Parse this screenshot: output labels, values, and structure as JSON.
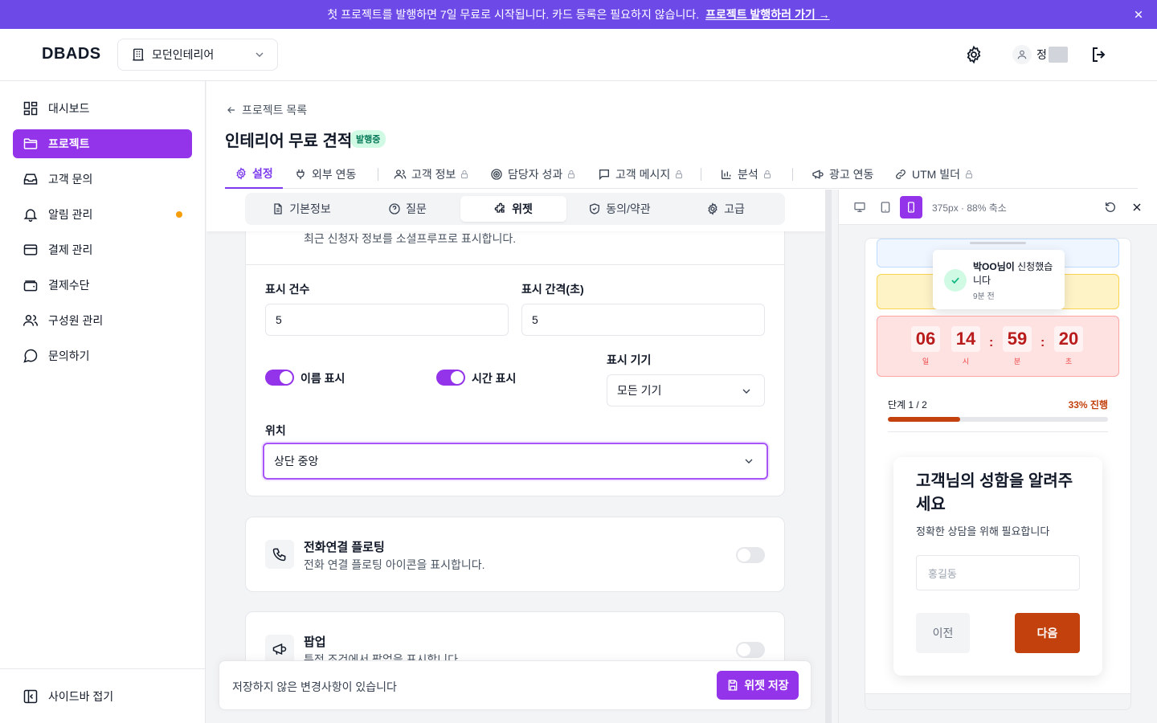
{
  "banner": {
    "text": "첫 프로젝트를 발행하면 7일 무료로 시작됩니다. 카드 등록은 필요하지 않습니다.",
    "link": "프로젝트 발행하러 가기 →"
  },
  "header": {
    "logo": "DBADS",
    "org": "모던인테리어",
    "user_name": "정"
  },
  "sidebar": {
    "items": [
      {
        "label": "대시보드",
        "icon": "dashboard-icon"
      },
      {
        "label": "프로젝트",
        "icon": "folder-icon",
        "active": true
      },
      {
        "label": "고객 문의",
        "icon": "inbox-icon"
      },
      {
        "label": "알림 관리",
        "icon": "bell-icon",
        "dot": true
      },
      {
        "label": "결제 관리",
        "icon": "card-icon"
      },
      {
        "label": "결제수단",
        "icon": "wallet-icon"
      },
      {
        "label": "구성원 관리",
        "icon": "users-icon"
      },
      {
        "label": "문의하기",
        "icon": "chat-icon"
      }
    ],
    "collapse": "사이드바 접기"
  },
  "page": {
    "back": "프로젝트 목록",
    "title": "인테리어 무료 견적",
    "badge": "발행중"
  },
  "tabs": [
    {
      "label": "설정",
      "active": true
    },
    {
      "label": "외부 연동"
    },
    {
      "label": "고객 정보",
      "locked": true
    },
    {
      "label": "담당자 성과",
      "locked": true
    },
    {
      "label": "고객 메시지",
      "locked": true
    },
    {
      "label": "분석",
      "locked": true
    },
    {
      "label": "광고 연동"
    },
    {
      "label": "UTM 빌더",
      "locked": true
    }
  ],
  "subtabs": [
    {
      "label": "기본정보"
    },
    {
      "label": "질문"
    },
    {
      "label": "위젯",
      "active": true
    },
    {
      "label": "동의/약관"
    },
    {
      "label": "고급"
    }
  ],
  "social_proof": {
    "desc": "최근 신청자 정보를 소셜프루프로 표시합니다.",
    "count_label": "표시 건수",
    "count_value": "5",
    "interval_label": "표시 간격(초)",
    "interval_value": "5",
    "show_name": "이름 표시",
    "show_time": "시간 표시",
    "device_label": "표시 기기",
    "device_value": "모든 기기",
    "position_label": "위치",
    "position_value": "상단 중앙"
  },
  "phone_floating": {
    "title": "전화연결 플로팅",
    "desc": "전화 연결 플로팅 아이콘을 표시합니다."
  },
  "popup": {
    "title": "팝업",
    "desc": "특정 조건에서 팝업을 표시합니다."
  },
  "savebar": {
    "message": "저장하지 않은 변경사항이 있습니다",
    "button": "위젯 저장"
  },
  "preview": {
    "size": "375px · 88% 축소",
    "toast_name": "박OO님이",
    "toast_rest": " 신청했습니다",
    "toast_time": "9분 전",
    "countdown": [
      {
        "value": "06",
        "unit": "일"
      },
      {
        "value": "14",
        "unit": "시"
      },
      {
        "value": "59",
        "unit": "분"
      },
      {
        "value": "20",
        "unit": "초"
      }
    ],
    "step": "단계 1 / 2",
    "progress_text": "33% 진행",
    "progress_pct": 33,
    "form_title": "고객님의 성함을 알려주세요",
    "form_sub": "정확한 상담을 위해 필요합니다",
    "form_placeholder": "홍길동",
    "prev": "이전",
    "next": "다음"
  },
  "colors": {
    "primary": "#9333ea",
    "banner": "#6d4ae8",
    "accent": "#c2410c"
  }
}
